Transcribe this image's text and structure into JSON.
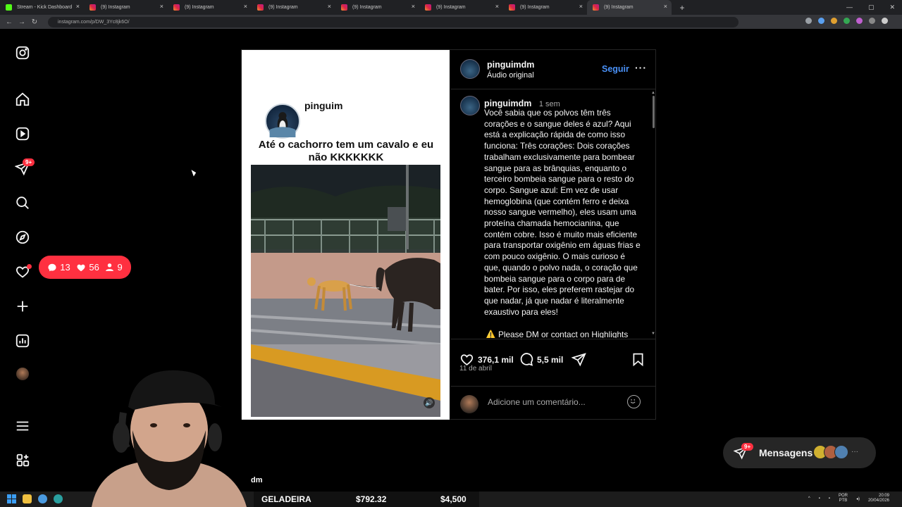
{
  "browser": {
    "tabs": [
      {
        "title": "Stream - Kick Dashboard",
        "favicon": "kick-icon",
        "active": false
      },
      {
        "title": "(9) Instagram",
        "favicon": "instagram-icon",
        "active": false
      },
      {
        "title": "(9) Instagram",
        "favicon": "instagram-icon",
        "active": false
      },
      {
        "title": "(9) Instagram",
        "favicon": "instagram-icon",
        "active": false
      },
      {
        "title": "(9) Instagram",
        "favicon": "instagram-icon",
        "active": false
      },
      {
        "title": "(9) Instagram",
        "favicon": "instagram-icon",
        "active": false
      },
      {
        "title": "(9) Instagram",
        "favicon": "instagram-icon",
        "active": false
      },
      {
        "title": "(9) Instagram",
        "favicon": "instagram-icon",
        "active": true
      }
    ],
    "url": "instagram.com/p/DW_3Yc8jk6O/"
  },
  "sidebar": {
    "items": [
      {
        "name": "home",
        "icon": "home-icon"
      },
      {
        "name": "reels",
        "icon": "reels-icon"
      },
      {
        "name": "direct",
        "icon": "send-icon",
        "badge": "9+"
      },
      {
        "name": "search",
        "icon": "search-icon"
      },
      {
        "name": "explore",
        "icon": "compass-icon"
      },
      {
        "name": "notifications",
        "icon": "heart-icon"
      },
      {
        "name": "create",
        "icon": "plus-icon"
      },
      {
        "name": "dashboard",
        "icon": "chart-icon"
      },
      {
        "name": "profile",
        "icon": "avatar"
      },
      {
        "name": "more",
        "icon": "menu-icon"
      },
      {
        "name": "also-from-meta",
        "icon": "apps-icon"
      }
    ],
    "notifications_bubble": {
      "comments": "13",
      "likes": "56",
      "follows": "9"
    }
  },
  "post": {
    "media": {
      "meme_username": "pinguim",
      "meme_caption": "Até o cachorro tem um cavalo e eu não KKKKKKK"
    },
    "header": {
      "username": "pinguimdm",
      "audio": "Áudio original",
      "follow_label": "Seguir",
      "more_label": "···"
    },
    "caption": {
      "username": "pinguimdm",
      "time": "1 sem",
      "text": "Você sabia que os polvos têm três corações e o sangue deles é azul? Aqui está a explicação rápida de como isso funciona: Três corações: Dois corações trabalham exclusivamente para bombear sangue para as brânquias, enquanto o terceiro bombeia sangue para o resto do corpo. Sangue azul: Em vez de usar hemoglobina (que contém ferro e deixa nosso sangue vermelho), eles usam uma proteína chamada hemocianina, que contém cobre. Isso é muito mais eficiente para transportar oxigênio em águas frias e com pouco oxigênio. O mais curioso é que, quando o polvo nada, o coração que bombeia sangue para o corpo para de bater. Por isso, eles preferem rastejar do que nadar, já que nadar é literalmente exaustivo para eles!",
      "warning": "⚠️ Please DM or contact on Highlights"
    },
    "likes": "376,1 mil",
    "comments": "5,5 mil",
    "date": "11 de abril",
    "comment_placeholder": "Adicione um comentário..."
  },
  "messages": {
    "label": "Mensagens",
    "badge": "9+"
  },
  "stream_overlay": {
    "partial_text": "dm",
    "ticker_label": "GELADEIRA",
    "ticker_value_1": "$792.32",
    "ticker_value_2": "$4,500"
  },
  "taskbar": {
    "lang_1": "POR",
    "lang_2": "PTB",
    "time": "20:09",
    "date": "20/04/2026"
  },
  "colors": {
    "accent": "#4a91f7",
    "badge": "#ff3040",
    "background": "#000000"
  }
}
